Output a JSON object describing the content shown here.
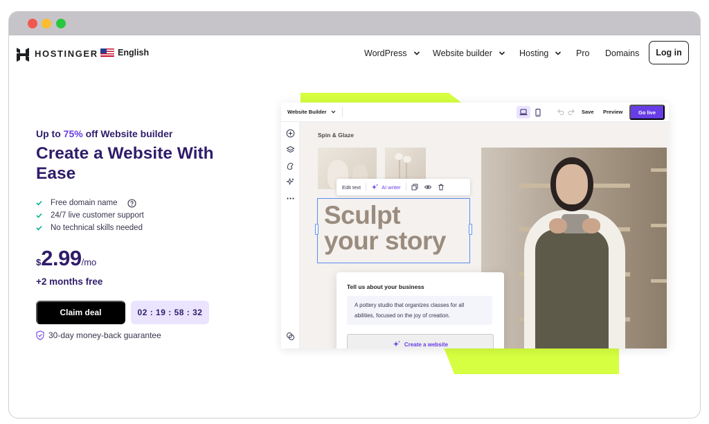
{
  "window": {
    "colors": {
      "close": "#f2574f",
      "minimize": "#fbbd2e",
      "maximize": "#29c740"
    }
  },
  "nav": {
    "brand": "HOSTINGER",
    "language": "English",
    "links": [
      {
        "label": "WordPress",
        "has_dropdown": true
      },
      {
        "label": "Website builder",
        "has_dropdown": true
      },
      {
        "label": "Hosting",
        "has_dropdown": true
      },
      {
        "label": "Pro",
        "has_dropdown": false
      },
      {
        "label": "Domains",
        "has_dropdown": false
      }
    ],
    "login": "Log in"
  },
  "hero": {
    "promo_prefix": "Up to ",
    "promo_percent": "75%",
    "promo_suffix": " off Website builder",
    "headline": "Create a Website With Ease",
    "features": [
      "Free domain name",
      "24/7 live customer support",
      "No technical skills needed"
    ],
    "price_currency": "$",
    "price_amount": "2.99",
    "price_period": "/mo",
    "bonus": "+2 months free",
    "cta": "Claim deal",
    "timer": "02 : 19 : 58 : 32",
    "guarantee": "30-day money-back guarantee",
    "colors": {
      "heading": "#2f1c6a",
      "accent": "#673de6",
      "check": "#00b090",
      "timer_bg": "#ebe4ff"
    }
  },
  "builder": {
    "title": "Website Builder",
    "save": "Save",
    "preview": "Preview",
    "go_live": "Go live",
    "site_name": "Spin & Glaze",
    "toolbar": {
      "edit_text": "Edit text",
      "ai_writer": "AI writer"
    },
    "hero_text_line1": "Sculpt",
    "hero_text_line2": "your story",
    "prompt_card": {
      "title": "Tell us about your business",
      "text": "A pottery studio that organizes classes for all abilities, focused on the joy of creation.",
      "button": "Create a website"
    },
    "colors": {
      "lime": "#d5ff40",
      "go_live": "#673de6",
      "selection": "#5b8def"
    }
  }
}
